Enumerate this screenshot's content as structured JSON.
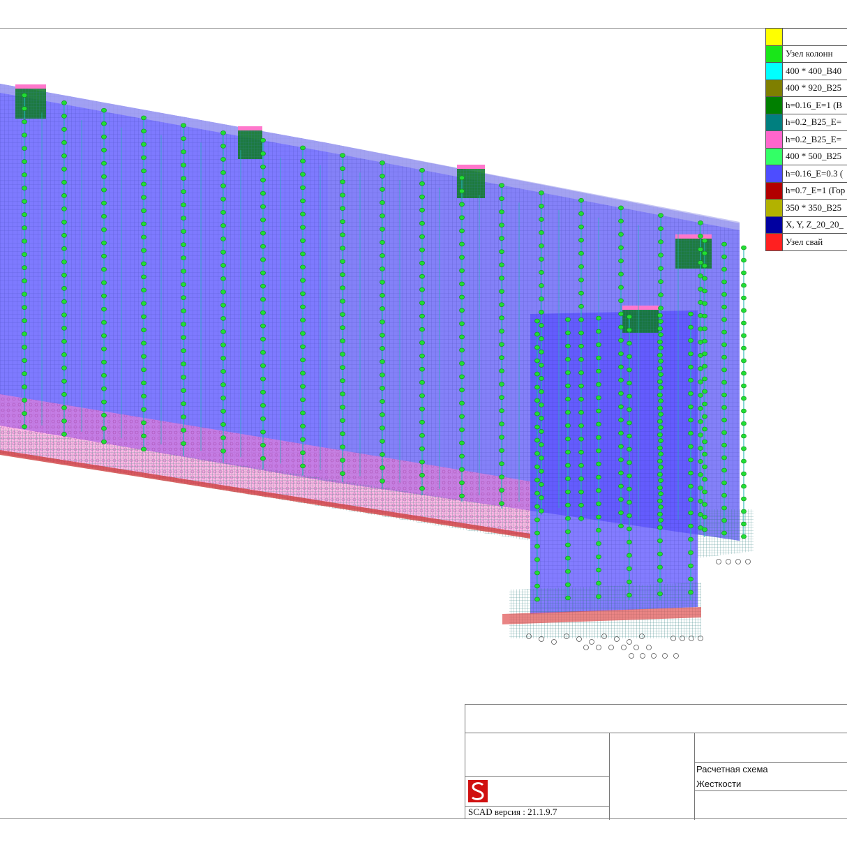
{
  "legend": {
    "items": [
      {
        "color": "#ffff00",
        "label": ""
      },
      {
        "color": "#19e619",
        "label": "Узел колонн"
      },
      {
        "color": "#00ffff",
        "label": "400 * 400_B40"
      },
      {
        "color": "#7f7f00",
        "label": "400 * 920_B25"
      },
      {
        "color": "#007f00",
        "label": "h=0.16_E=1 (B"
      },
      {
        "color": "#007f7f",
        "label": "h=0.2_B25_E="
      },
      {
        "color": "#ff66cc",
        "label": "h=0.2_B25_E="
      },
      {
        "color": "#33ff66",
        "label": "400 * 500_B25"
      },
      {
        "color": "#4d4dff",
        "label": "h=0.16_E=0.3 ("
      },
      {
        "color": "#b20000",
        "label": "h=0.7_E=1 (Гор"
      },
      {
        "color": "#b2b200",
        "label": "350 * 350_B25"
      },
      {
        "color": "#0000a0",
        "label": "X, Y, Z_20_20_"
      },
      {
        "color": "#ff2020",
        "label": "Узел свай"
      }
    ]
  },
  "title_block": {
    "scheme_title": "Расчетная схема",
    "scheme_subtitle": "Жесткости",
    "version": "SCAD версия : 21.1.9.7"
  },
  "model": {
    "colors": {
      "wall_fill": "#5a55ff",
      "grid": "#4040c0",
      "column": "#1fb5b5",
      "node": "#22dd33",
      "slab": "#ff77cc",
      "foundation": "#2a8f8f",
      "pile_node": "#e03030",
      "core": "#0c7a20"
    }
  }
}
